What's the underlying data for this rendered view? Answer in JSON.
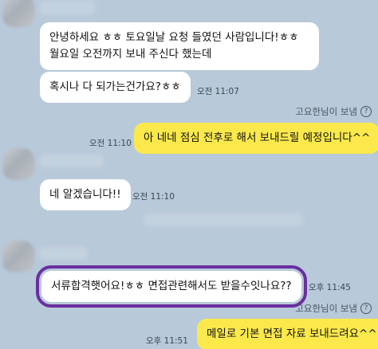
{
  "messages": [
    {
      "lines": [
        "안녕하세요 ㅎㅎ 토요일날 요청 들였던 사람입니다!ㅎㅎ",
        "월요일 오전까지 보내 주신다 했는데"
      ]
    },
    {
      "text": "혹시나 다 되가는건가요?ㅎㅎ",
      "time": "오전 11:07"
    },
    {
      "sender": "고요한님이 보냄",
      "text": "아 네네 점심 전후로 해서 보내드릴 예정입니다^^",
      "time": "오전 11:10"
    },
    {
      "text": "네 알겠습니다!!",
      "time": "오전 11:10"
    },
    {
      "text": "서류합격햇어요!ㅎㅎ 면접관련해서도 받을수잇나요??",
      "time": "오후 11:45"
    },
    {
      "sender": "고요한님이 보냄",
      "text": "메일로 기본 면접 자료 보내드려요^^",
      "time": "오후 11:51"
    }
  ],
  "help_glyph": "?",
  "colors": {
    "background": "#b8c9da",
    "incoming_bubble": "#ffffff",
    "outgoing_bubble": "#fbe94b",
    "highlight_border": "#6a2fa0"
  },
  "icons": {
    "help": "question-circle-icon"
  }
}
